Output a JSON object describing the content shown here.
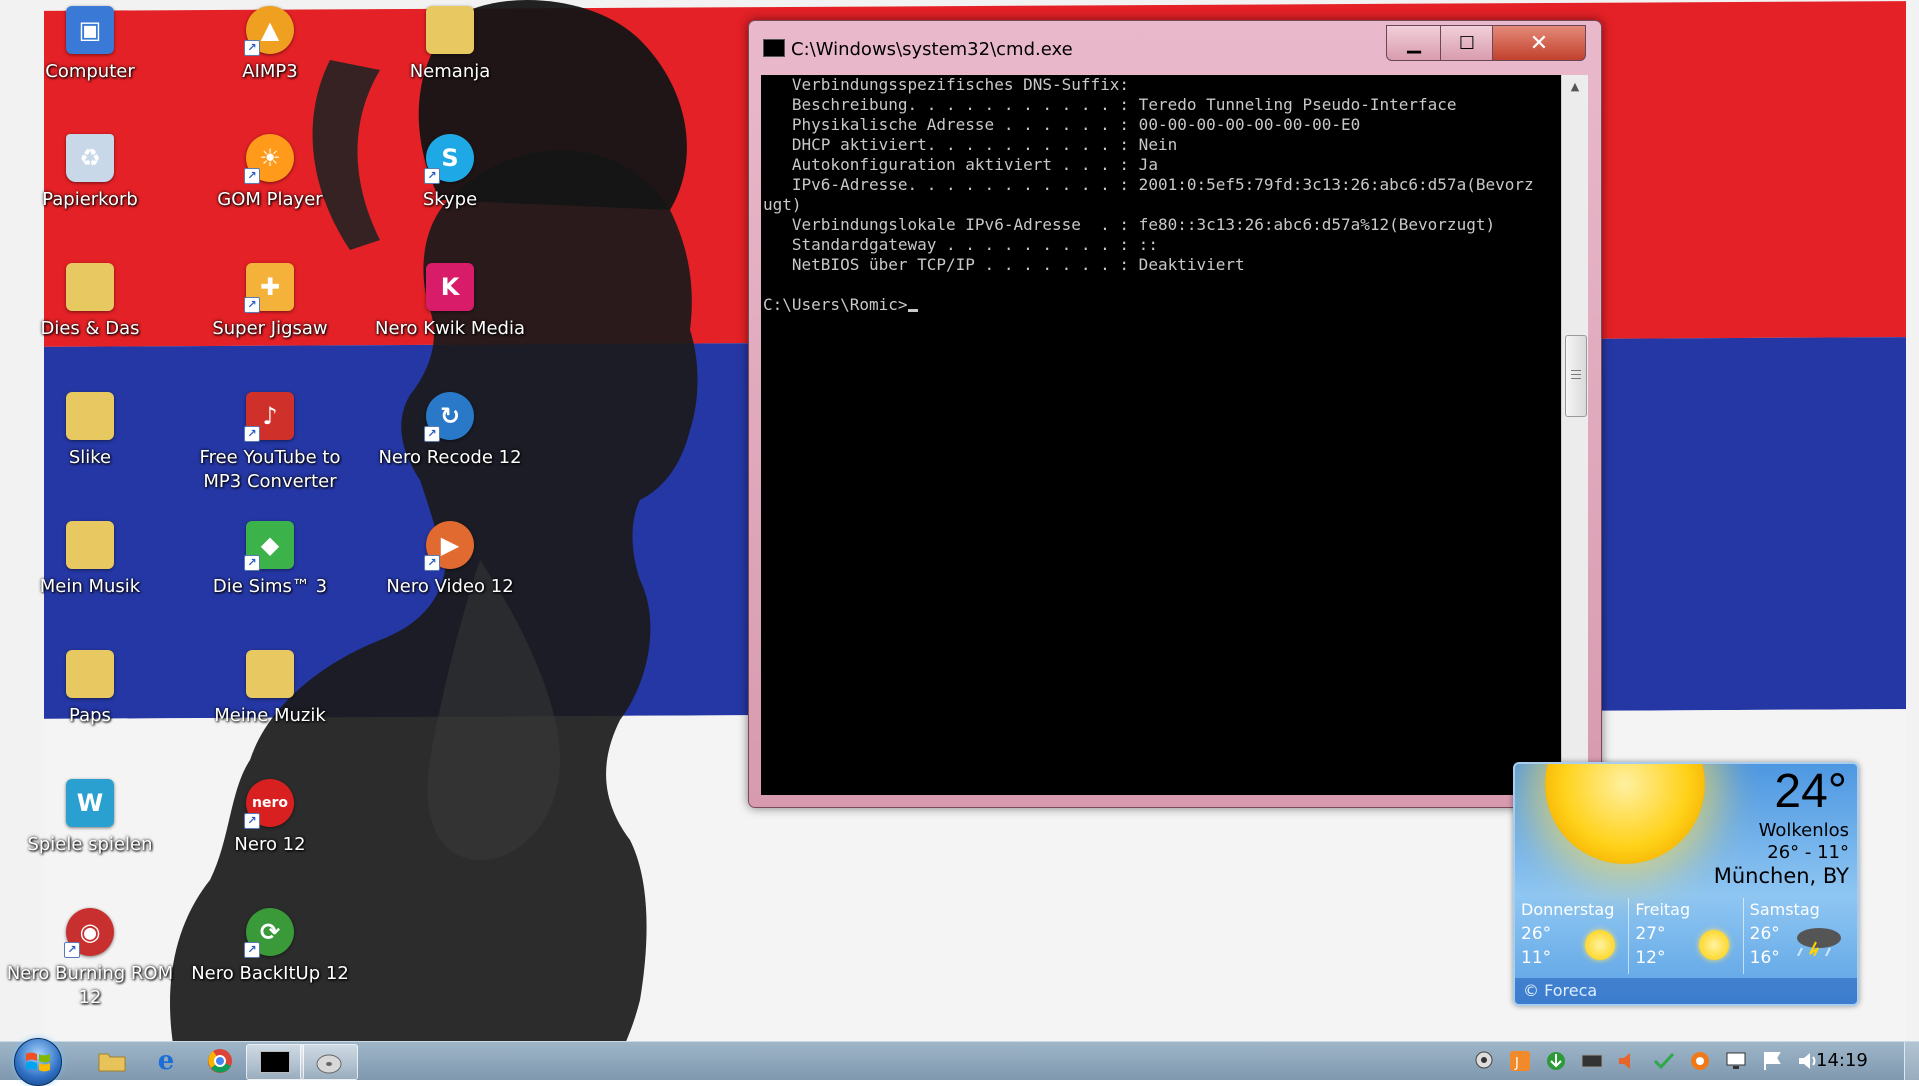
{
  "desktop": {
    "icons": [
      {
        "label": "Computer",
        "icon": "computer-icon",
        "color": "#3a7ad6"
      },
      {
        "label": "AIMP3",
        "icon": "aimp-icon",
        "color": "#f0a020"
      },
      {
        "label": "Nemanja",
        "icon": "folder-icon",
        "color": "#e8c860"
      },
      {
        "label": "Papierkorb",
        "icon": "recycle-bin-icon",
        "color": "#c8d8e8"
      },
      {
        "label": "GOM Player",
        "icon": "gom-player-icon",
        "color": "#ff9a1a"
      },
      {
        "label": "Skype",
        "icon": "skype-icon",
        "color": "#1ea8e6"
      },
      {
        "label": "Dies & Das",
        "icon": "folder-icon",
        "color": "#e8c860"
      },
      {
        "label": "Super Jigsaw",
        "icon": "jigsaw-icon",
        "color": "#f5b23a"
      },
      {
        "label": "Nero Kwik Media",
        "icon": "nero-kwik-icon",
        "color": "#d81c6a"
      },
      {
        "label": "Slike",
        "icon": "folder-icon",
        "color": "#e8c860"
      },
      {
        "label": "Free YouTube to MP3 Converter",
        "icon": "youtube-mp3-icon",
        "color": "#d0302a"
      },
      {
        "label": "Nero Recode 12",
        "icon": "nero-recode-icon",
        "color": "#2a78c8"
      },
      {
        "label": "Mein Musik",
        "icon": "folder-icon",
        "color": "#e8c860"
      },
      {
        "label": "Die Sims™ 3",
        "icon": "sims-icon",
        "color": "#3cb24a"
      },
      {
        "label": "Nero Video 12",
        "icon": "nero-video-icon",
        "color": "#e06a30"
      },
      {
        "label": "Paps",
        "icon": "folder-icon",
        "color": "#e8c860"
      },
      {
        "label": "Meine Muzik",
        "icon": "folder-icon",
        "color": "#e8c860"
      },
      {
        "label": "Spiele spielen",
        "icon": "games-icon",
        "color": "#2aa0d0"
      },
      {
        "label": "Nero 12",
        "icon": "nero-icon",
        "color": "#d82020"
      },
      {
        "label": "Nero Burning ROM 12",
        "icon": "nero-burning-icon",
        "color": "#c83030"
      },
      {
        "label": "Nero BackItUp 12",
        "icon": "nero-backitup-icon",
        "color": "#3a9a3a"
      }
    ]
  },
  "cmd": {
    "title": "C:\\Windows\\system32\\cmd.exe",
    "lines": [
      "   Verbindungsspezifisches DNS-Suffix:",
      "   Beschreibung. . . . . . . . . . . : Teredo Tunneling Pseudo-Interface",
      "   Physikalische Adresse . . . . . . : 00-00-00-00-00-00-00-E0",
      "   DHCP aktiviert. . . . . . . . . . : Nein",
      "   Autokonfiguration aktiviert . . . : Ja",
      "   IPv6-Adresse. . . . . . . . . . . : 2001:0:5ef5:79fd:3c13:26:abc6:d57a(Bevorz",
      "ugt)",
      "   Verbindungslokale IPv6-Adresse  . : fe80::3c13:26:abc6:d57a%12(Bevorzugt)",
      "   Standardgateway . . . . . . . . . : ::",
      "   NetBIOS über TCP/IP . . . . . . . : Deaktiviert",
      ""
    ],
    "prompt": "C:\\Users\\Romic>"
  },
  "weather": {
    "temp": "24°",
    "condition": "Wolkenlos",
    "range": "26° - 11°",
    "city": "München, BY",
    "days": [
      {
        "name": "Donnerstag",
        "hi": "26°",
        "lo": "11°",
        "icon": "sun-icon"
      },
      {
        "name": "Freitag",
        "hi": "27°",
        "lo": "12°",
        "icon": "sun-icon"
      },
      {
        "name": "Samstag",
        "hi": "26°",
        "lo": "16°",
        "icon": "thunderstorm-icon"
      }
    ],
    "footer": "© Foreca"
  },
  "taskbar": {
    "clock": "14:19",
    "pinned": [
      {
        "name": "explorer",
        "icon": "folder-icon"
      },
      {
        "name": "internet-explorer",
        "icon": "ie-icon"
      },
      {
        "name": "chrome",
        "icon": "chrome-icon"
      },
      {
        "name": "cmd",
        "icon": "cmd-icon",
        "active": true
      },
      {
        "name": "disc-app",
        "icon": "disc-icon",
        "active": true
      }
    ],
    "tray": [
      "webcam-icon",
      "java-icon",
      "download-icon",
      "network-card-icon",
      "volume-icon",
      "security-check-icon",
      "avast-icon",
      "monitor-icon",
      "flag-icon",
      "speaker-icon"
    ]
  }
}
